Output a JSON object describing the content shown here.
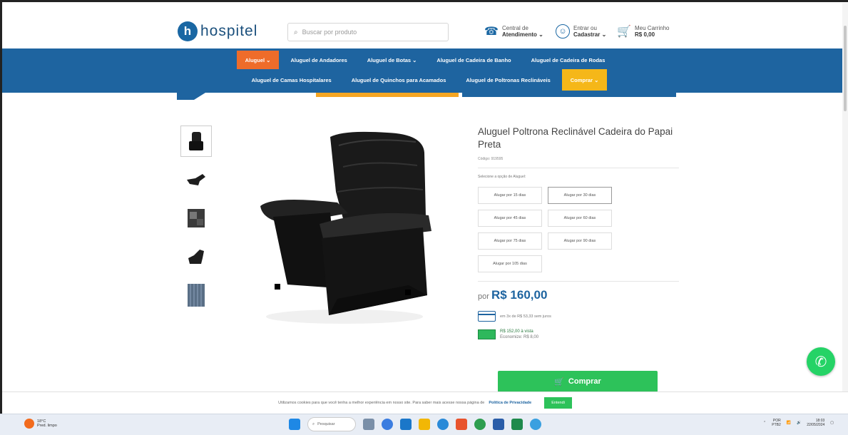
{
  "header": {
    "logo_text": "hospitel",
    "search_placeholder": "Buscar por produto",
    "central": {
      "line1": "Central de",
      "line2": "Atendimento ⌄"
    },
    "login": {
      "line1": "Entrar ou",
      "line2": "Cadastrar ⌄"
    },
    "cart": {
      "line1": "Meu Carrinho",
      "line2": "R$ 0,00",
      "count": "0"
    }
  },
  "nav": {
    "row1": [
      "Aluguel ⌄",
      "Aluguel de Andadores",
      "Aluguel de Botas ⌄",
      "Aluguel de Cadeira de Banho",
      "Aluguel de Cadeira de Rodas"
    ],
    "row2": [
      "Aluguel de Camas Hospitalares",
      "Aluguel de Quinchos para Acamados",
      "Aluguel de Poltronas Reclináveis",
      "Comprar ⌄"
    ]
  },
  "product": {
    "title": "Aluguel Poltrona Reclinável Cadeira do Papai Preta",
    "code": "Código: 919595",
    "select_label": "Selecione a opção de Aluguel:",
    "options": [
      "Alugar por 15 dias",
      "Alugar por 30 dias",
      "Alugar por 45 dias",
      "Alugar por 60 dias",
      "Alugar por 75 dias",
      "Alugar por 90 dias",
      "Alugar por 105 dias"
    ],
    "selected_option": "Alugar por 30 dias",
    "price_prefix": "por",
    "price": "R$ 160,00",
    "installments": "em 3x de R$ 53,33 sem juros",
    "cash_price": "R$ 152,00 à vista",
    "cash_savings": "Economize: R$ 8,00",
    "buy_label": "Comprar"
  },
  "cookie": {
    "text": "Utilizamos cookies para que você tenha a melhor experiência em nosso site. Para saber mais acesse nossa página de",
    "policy": "Política de Privacidade",
    "button": "Entendi"
  },
  "taskbar": {
    "weather_temp": "18°C",
    "weather_desc": "Pred. limpo",
    "search_label": "Pesquisar",
    "lang": "POR",
    "lang2": "PTB2",
    "time": "18:03",
    "date": "22/05/2024"
  },
  "colors": {
    "brand": "#1e64a0",
    "orange": "#ee6c2a",
    "yellow": "#f5b719",
    "green": "#2dc25a"
  }
}
